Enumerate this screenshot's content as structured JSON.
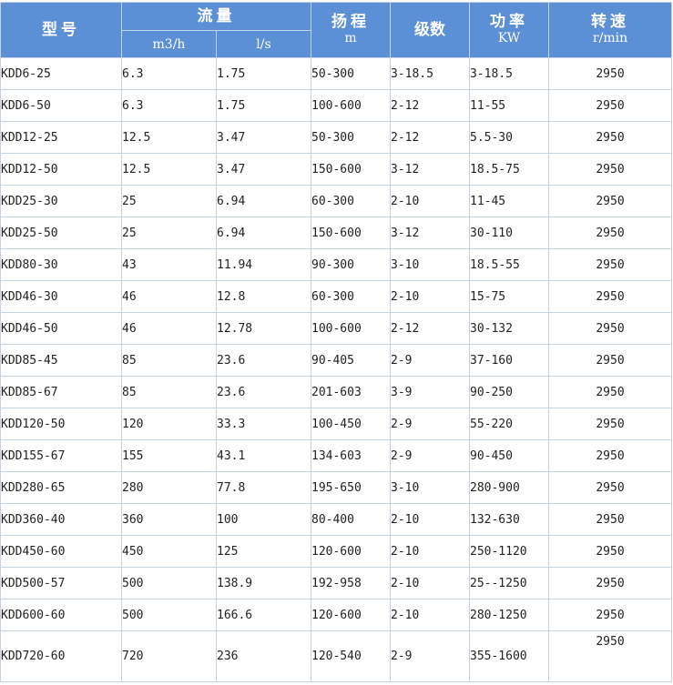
{
  "table": {
    "headers": {
      "model": "型号",
      "flow": "流量",
      "flow_m3h": "m3/h",
      "flow_ls": "l/s",
      "head": "扬程",
      "head_unit": "m",
      "stages": "级数",
      "power": "功率",
      "power_unit": "KW",
      "speed": "转速",
      "speed_unit": "r/min"
    },
    "rows": [
      [
        "KDD6-25",
        "6.3",
        "1.75",
        "50-300",
        "3-18.5",
        "3-18.5",
        "2950"
      ],
      [
        "KDD6-50",
        "6.3",
        "1.75",
        "100-600",
        "2-12",
        "11-55",
        "2950"
      ],
      [
        "KDD12-25",
        "12.5",
        "3.47",
        "50-300",
        "2-12",
        "5.5-30",
        "2950"
      ],
      [
        "KDD12-50",
        "12.5",
        "3.47",
        "150-600",
        "3-12",
        "18.5-75",
        "2950"
      ],
      [
        "KDD25-30",
        "25",
        "6.94",
        "60-300",
        "2-10",
        "11-45",
        "2950"
      ],
      [
        "KDD25-50",
        "25",
        "6.94",
        "150-600",
        "3-12",
        "30-110",
        "2950"
      ],
      [
        "KDD80-30",
        "43",
        "11.94",
        "90-300",
        "3-10",
        "18.5-55",
        "2950"
      ],
      [
        "KDD46-30",
        "46",
        "12.8",
        "60-300",
        "2-10",
        "15-75",
        "2950"
      ],
      [
        "KDD46-50",
        "46",
        "12.78",
        "100-600",
        "2-12",
        "30-132",
        "2950"
      ],
      [
        "KDD85-45",
        "85",
        "23.6",
        "90-405",
        "2-9",
        "37-160",
        "2950"
      ],
      [
        "KDD85-67",
        "85",
        "23.6",
        "201-603",
        "3-9",
        "90-250",
        "2950"
      ],
      [
        "KDD120-50",
        "120",
        "33.3",
        "100-450",
        "2-9",
        "55-220",
        "2950"
      ],
      [
        "KDD155-67",
        "155",
        "43.1",
        "134-603",
        "2-9",
        "90-450",
        "2950"
      ],
      [
        "KDD280-65",
        "280",
        "77.8",
        "195-650",
        "3-10",
        "280-900",
        "2950"
      ],
      [
        "KDD360-40",
        "360",
        "100",
        "80-400",
        "2-10",
        "132-630",
        "2950"
      ],
      [
        "KDD450-60",
        "450",
        "125",
        "120-600",
        "2-10",
        "250-1120",
        "2950"
      ],
      [
        "KDD500-57",
        "500",
        "138.9",
        "192-958",
        "2-10",
        "25--1250",
        "2950"
      ],
      [
        "KDD600-60",
        "500",
        "166.6",
        "120-600",
        "2-10",
        "280-1250",
        "2950"
      ],
      [
        "KDD720-60",
        "720",
        "236",
        "120-540",
        "2-9",
        "355-1600",
        "2950"
      ]
    ]
  }
}
